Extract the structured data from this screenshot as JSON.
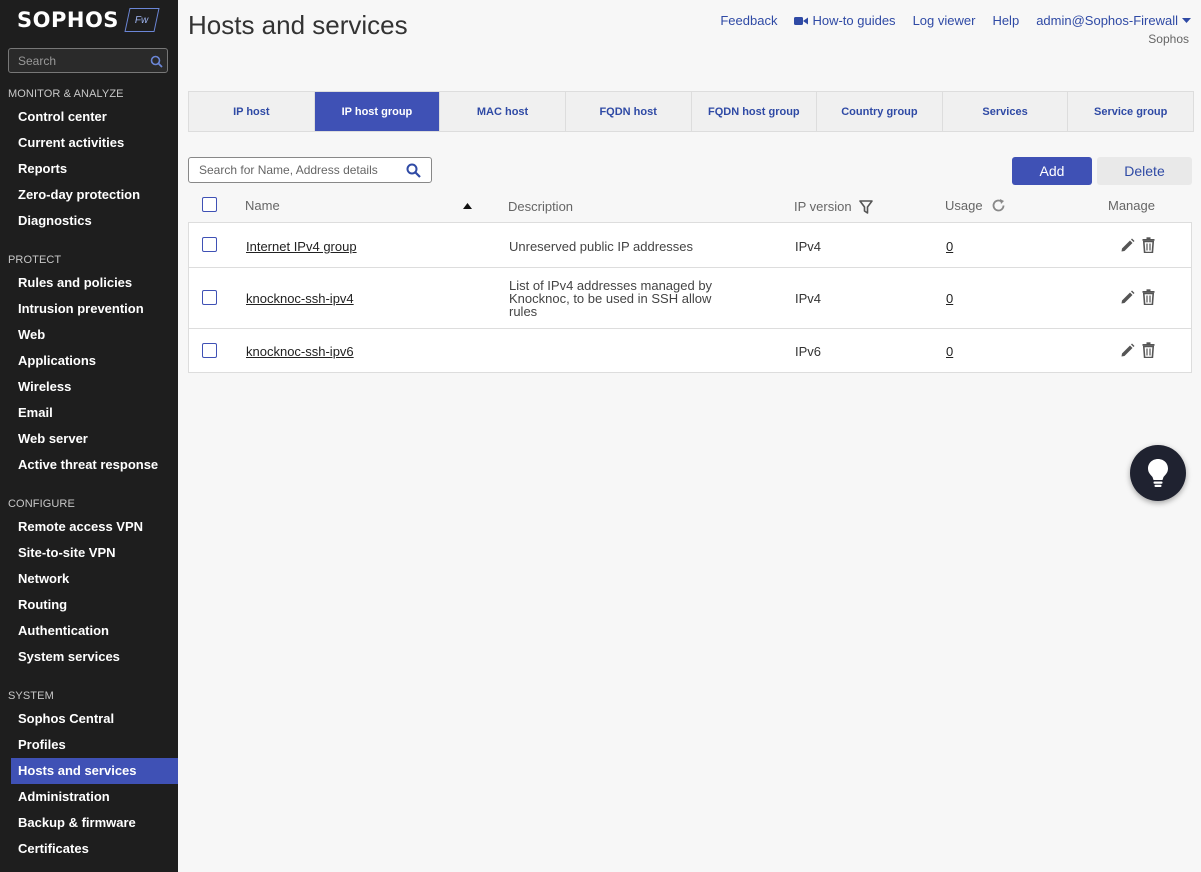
{
  "brand": {
    "name": "SOPHOS",
    "badge": "Fw"
  },
  "sidebar": {
    "search_placeholder": "Search",
    "sections": [
      {
        "title": "MONITOR & ANALYZE",
        "items": [
          "Control center",
          "Current activities",
          "Reports",
          "Zero-day protection",
          "Diagnostics"
        ]
      },
      {
        "title": "PROTECT",
        "items": [
          "Rules and policies",
          "Intrusion prevention",
          "Web",
          "Applications",
          "Wireless",
          "Email",
          "Web server",
          "Active threat response"
        ]
      },
      {
        "title": "CONFIGURE",
        "items": [
          "Remote access VPN",
          "Site-to-site VPN",
          "Network",
          "Routing",
          "Authentication",
          "System services"
        ]
      },
      {
        "title": "SYSTEM",
        "items": [
          "Sophos Central",
          "Profiles",
          "Hosts and services",
          "Administration",
          "Backup & firmware",
          "Certificates"
        ]
      }
    ],
    "active_item": "Hosts and services"
  },
  "header": {
    "title": "Hosts and services",
    "links": {
      "feedback": "Feedback",
      "howto": "How-to guides",
      "logviewer": "Log viewer",
      "help": "Help"
    },
    "user": "admin@Sophos-Firewall",
    "user_sub": "Sophos"
  },
  "tabs": [
    "IP host",
    "IP host group",
    "MAC host",
    "FQDN host",
    "FQDN host group",
    "Country group",
    "Services",
    "Service group"
  ],
  "active_tab": "IP host group",
  "toolbar": {
    "search_placeholder": "Search for Name, Address details",
    "add": "Add",
    "delete": "Delete"
  },
  "table": {
    "columns": {
      "name": "Name",
      "description": "Description",
      "ip_version": "IP version",
      "usage": "Usage",
      "manage": "Manage"
    },
    "rows": [
      {
        "name": "Internet IPv4 group",
        "description": "Unreserved public IP addresses",
        "ip_version": "IPv4",
        "usage": "0"
      },
      {
        "name": "knocknoc-ssh-ipv4",
        "description": "List of IPv4 addresses managed by Knocknoc, to be used in SSH allow rules",
        "ip_version": "IPv4",
        "usage": "0"
      },
      {
        "name": "knocknoc-ssh-ipv6",
        "description": "",
        "ip_version": "IPv6",
        "usage": "0"
      }
    ]
  },
  "colors": {
    "accent": "#3f51b5",
    "sidebar_bg": "#1e1e1e",
    "link": "#2f4aa5"
  }
}
